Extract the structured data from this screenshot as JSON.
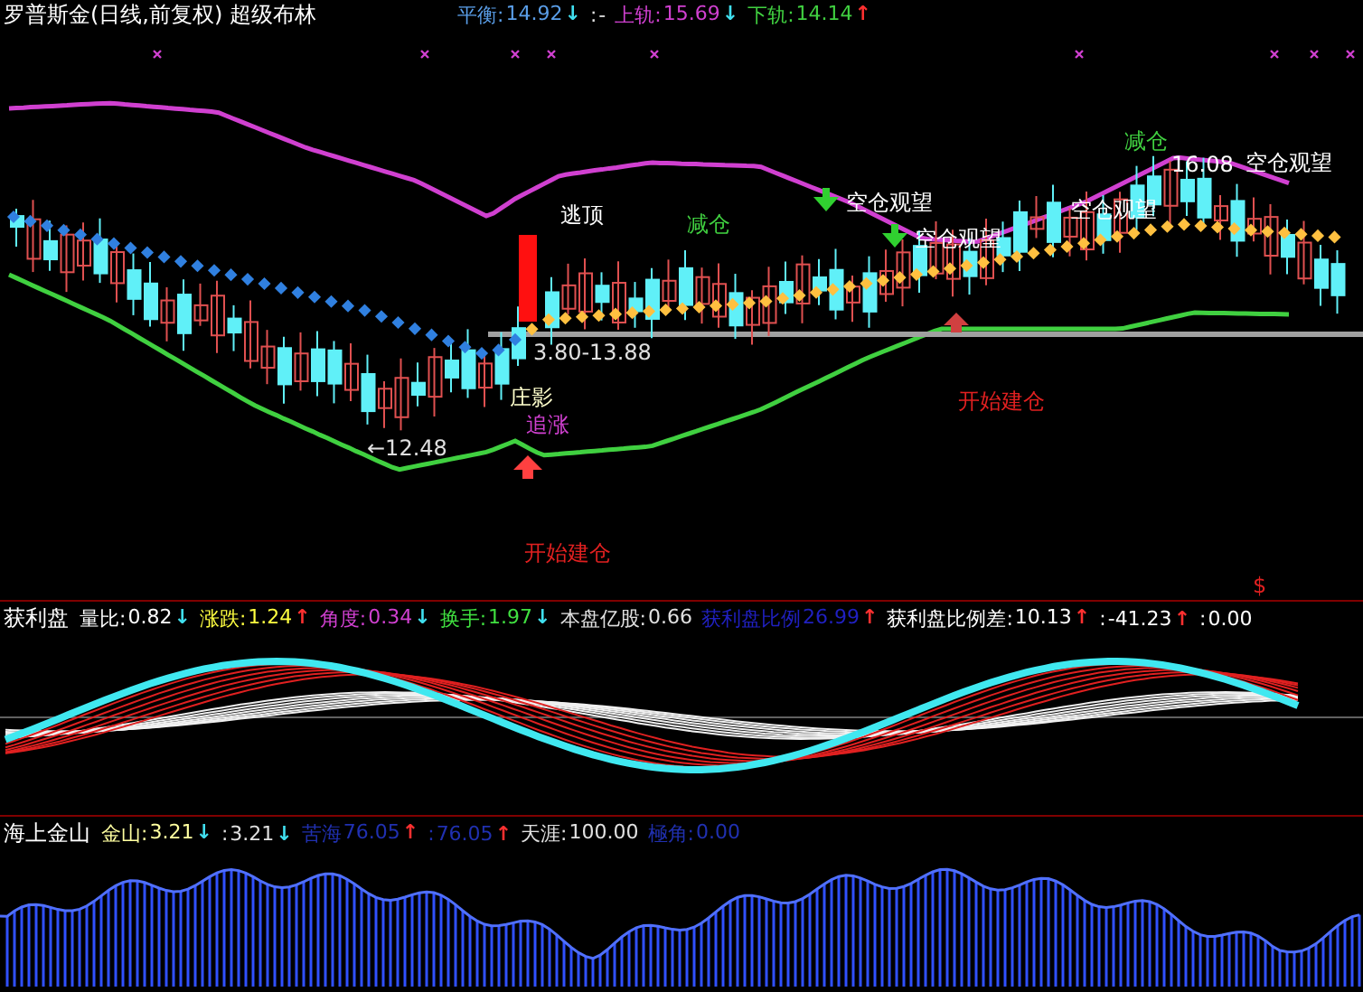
{
  "main_panel": {
    "title": "罗普斯金(日线,前复权) 超级布林",
    "readouts": [
      {
        "label": "平衡:",
        "value": "14.92",
        "arrow": {
          "text": "↓",
          "color": "#40e0f0"
        },
        "color": "#5a9ee8"
      },
      {
        "label": ":",
        "value": "-",
        "color": "#e0e0e0"
      },
      {
        "label": "上轨:",
        "value": "15.69",
        "arrow": {
          "text": "↓",
          "color": "#40e0f0"
        },
        "color": "#d040d0"
      },
      {
        "label": "下轨:",
        "value": "14.14",
        "arrow": {
          "text": "↑",
          "color": "#ff3030"
        },
        "color": "#40d040"
      }
    ],
    "annotations": [
      {
        "text": "逃顶",
        "color": "#ffffff"
      },
      {
        "text": "减仓",
        "color": "#40d040"
      },
      {
        "text": "空仓观望",
        "color": "#ffffff"
      },
      {
        "text": "空仓观望",
        "color": "#ffffff"
      },
      {
        "text": "空仓观望",
        "color": "#ffffff"
      },
      {
        "text": "减仓",
        "color": "#40d040"
      },
      {
        "text": "16.08",
        "color": "#ffffff"
      },
      {
        "text": "空仓观望",
        "color": "#ffffff"
      },
      {
        "text": "3.80-13.88",
        "color": "#e0e0e0"
      },
      {
        "text": "←12.48",
        "color": "#e0e0e0"
      },
      {
        "text": "庄影",
        "color": "#ffffcc"
      },
      {
        "text": "追涨",
        "color": "#d040d0"
      },
      {
        "text": "开始建仓",
        "color": "#e02020"
      },
      {
        "text": "开始建仓",
        "color": "#e02020"
      },
      {
        "text": "$",
        "color": "#e02020"
      }
    ]
  },
  "profit_panel": {
    "title": "获利盘",
    "readouts": [
      {
        "label": "量比:",
        "value": "0.82",
        "arrow": {
          "text": "↓",
          "color": "#40e0f0"
        },
        "color": "#ffffff"
      },
      {
        "label": "涨跌:",
        "value": "1.24",
        "arrow": {
          "text": "↑",
          "color": "#ff3030"
        },
        "color": "#ffff40"
      },
      {
        "label": "角度:",
        "value": "0.34",
        "arrow": {
          "text": "↓",
          "color": "#40e0f0"
        },
        "color": "#d040d0"
      },
      {
        "label": "换手:",
        "value": "1.97",
        "arrow": {
          "text": "↓",
          "color": "#40e0f0"
        },
        "color": "#40e040"
      },
      {
        "label": "本盘亿股:",
        "value": "0.66",
        "color": "#e0e0e0"
      },
      {
        "label": "获利盘比例",
        "value": "26.99",
        "arrow": {
          "text": "↑",
          "color": "#ff3030"
        },
        "color": "#2020c0"
      },
      {
        "label": "获利盘比例差:",
        "value": "10.13",
        "arrow": {
          "text": "↑",
          "color": "#ff3030"
        },
        "color": "#ffffff"
      },
      {
        "label": ":",
        "value": "-41.23",
        "arrow": {
          "text": "↑",
          "color": "#ff3030"
        },
        "color": "#ffffff"
      },
      {
        "label": ":",
        "value": "0.00",
        "color": "#ffffff"
      }
    ]
  },
  "gold_panel": {
    "title": "海上金山",
    "readouts": [
      {
        "label": "金山:",
        "value": "3.21",
        "arrow": {
          "text": "↓",
          "color": "#40e0f0"
        },
        "color": "#ffffa0"
      },
      {
        "label": ":",
        "value": "3.21",
        "arrow": {
          "text": "↓",
          "color": "#40e0f0"
        },
        "color": "#e0e0e0"
      },
      {
        "label": "苦海",
        "value": "76.05",
        "arrow": {
          "text": "↑",
          "color": "#ff3030"
        },
        "color": "#2030b0"
      },
      {
        "label": ":",
        "value": "76.05",
        "arrow": {
          "text": "↑",
          "color": "#ff3030"
        },
        "color": "#2030b0"
      },
      {
        "label": "天涯:",
        "value": "100.00",
        "color": "#e0e0e0"
      },
      {
        "label": "極角:",
        "value": "0.00",
        "color": "#2030b0"
      }
    ]
  }
}
